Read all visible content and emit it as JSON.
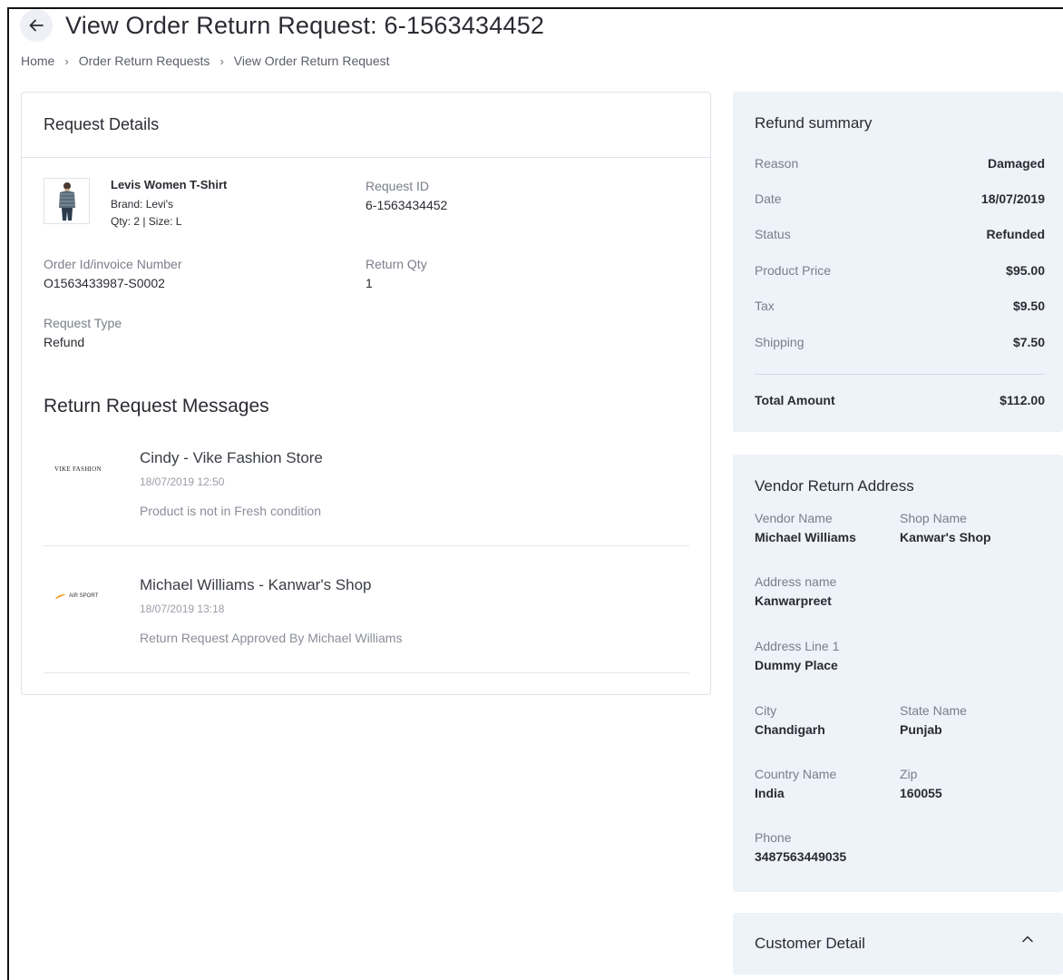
{
  "header": {
    "back_icon": "arrow-left-icon",
    "title": "View Order Return Request: 6-1563434452"
  },
  "breadcrumb": [
    "Home",
    "Order Return Requests",
    "View Order Return Request"
  ],
  "request_details": {
    "heading": "Request Details",
    "product": {
      "name": "Levis Women T-Shirt",
      "brand": "Brand: Levi's",
      "qty_size": "Qty: 2 | Size: L",
      "image": "t-shirt-product-image"
    },
    "request_id": {
      "label": "Request ID",
      "value": "6-1563434452"
    },
    "order_id": {
      "label": "Order Id/invoice Number",
      "value": "O1563433987-S0002"
    },
    "return_qty": {
      "label": "Return Qty",
      "value": "1"
    },
    "request_type": {
      "label": "Request Type",
      "value": "Refund"
    }
  },
  "messages": {
    "heading": "Return Request Messages",
    "items": [
      {
        "logo": "vike-fashion-logo",
        "logo_text": "VIKE FASHION",
        "sender": "Cindy - Vike Fashion Store",
        "time": "18/07/2019 12:50",
        "text": "Product is not in Fresh condition"
      },
      {
        "logo": "air-sport-logo",
        "logo_text": "AIR SPORT",
        "sender": "Michael Williams - Kanwar's Shop",
        "time": "18/07/2019 13:18",
        "text": "Return Request Approved By Michael Williams"
      }
    ]
  },
  "refund_summary": {
    "heading": "Refund summary",
    "rows": [
      {
        "label": "Reason",
        "value": "Damaged"
      },
      {
        "label": "Date",
        "value": "18/07/2019"
      },
      {
        "label": "Status",
        "value": "Refunded"
      },
      {
        "label": "Product Price",
        "value": "$95.00"
      },
      {
        "label": "Tax",
        "value": "$9.50"
      },
      {
        "label": "Shipping",
        "value": "$7.50"
      }
    ],
    "total": {
      "label": "Total Amount",
      "value": "$112.00"
    }
  },
  "vendor_address": {
    "heading": "Vendor Return Address",
    "vendor_name": {
      "label": "Vendor Name",
      "value": "Michael Williams"
    },
    "shop_name": {
      "label": "Shop Name",
      "value": "Kanwar's Shop"
    },
    "address_name": {
      "label": "Address name",
      "value": "Kanwarpreet"
    },
    "address_line1": {
      "label": "Address Line 1",
      "value": "Dummy Place"
    },
    "city": {
      "label": "City",
      "value": "Chandigarh"
    },
    "state": {
      "label": "State Name",
      "value": "Punjab"
    },
    "country": {
      "label": "Country Name",
      "value": "India"
    },
    "zip": {
      "label": "Zip",
      "value": "160055"
    },
    "phone": {
      "label": "Phone",
      "value": "3487563449035"
    }
  },
  "customer_detail": {
    "heading": "Customer Detail",
    "toggle_icon": "chevron-up-icon"
  },
  "colors": {
    "panel_bg": "#eef2f9",
    "border": "#dfe2ea",
    "text": "#2b2b33",
    "muted": "#7a7e89"
  }
}
